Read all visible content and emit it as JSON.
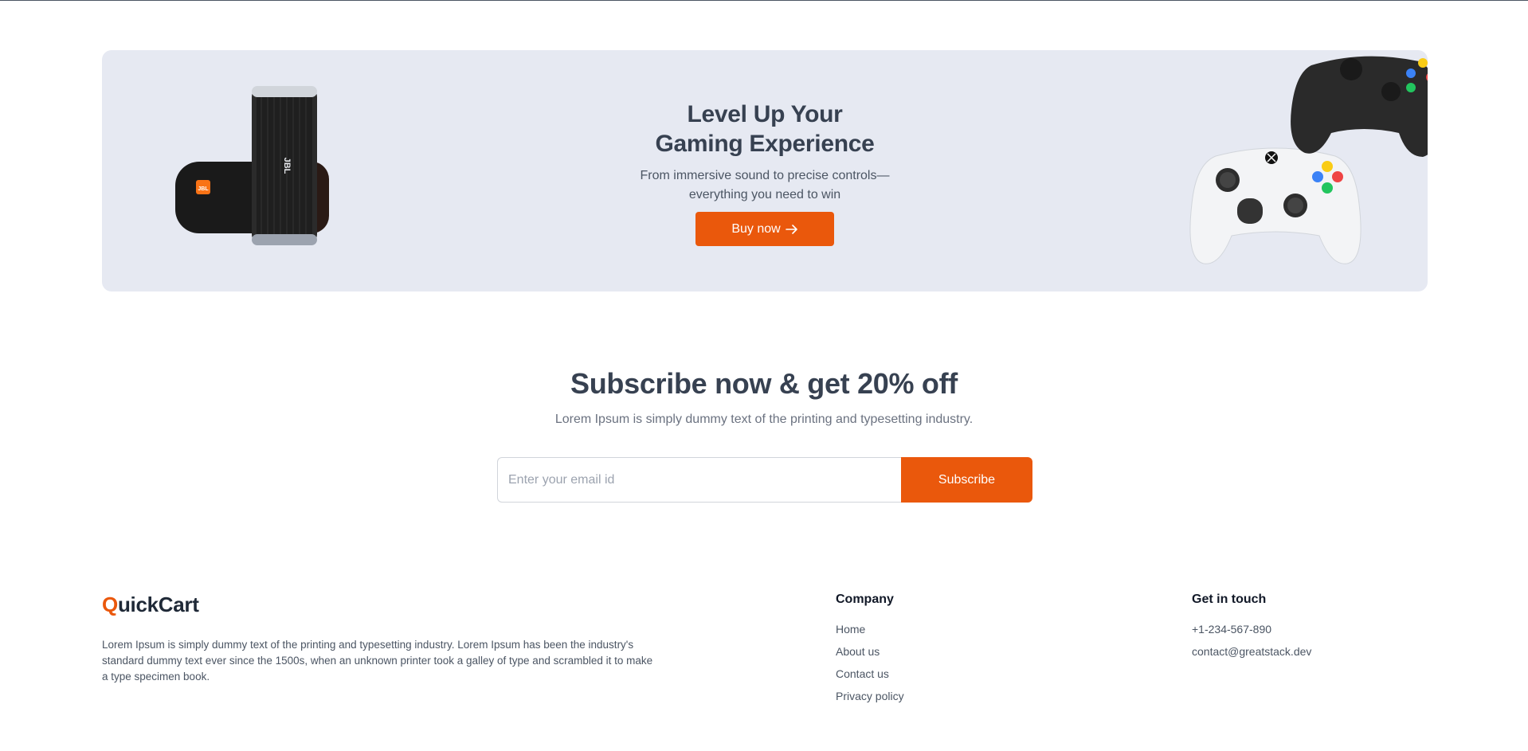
{
  "banner": {
    "title_line1": "Level Up Your",
    "title_line2": "Gaming Experience",
    "subtitle": "From immersive sound to precise controls—everything you need to win",
    "button_label": "Buy now",
    "button_icon": "arrow-right-icon",
    "speaker_brand": "JBL",
    "accent_color": "#ea580c",
    "background_color": "#e6e9f2"
  },
  "subscribe": {
    "title": "Subscribe now & get 20% off",
    "subtitle": "Lorem Ipsum is simply dummy text of the printing and typesetting industry.",
    "email_placeholder": "Enter your email id",
    "email_value": "",
    "button_label": "Subscribe"
  },
  "footer": {
    "logo_first_letter": "Q",
    "logo_rest": "uickCart",
    "about": "Lorem Ipsum is simply dummy text of the printing and typesetting industry. Lorem Ipsum has been the industry's standard dummy text ever since the 1500s, when an unknown printer took a galley of type and scrambled it to make a type specimen book.",
    "company": {
      "heading": "Company",
      "links": [
        "Home",
        "About us",
        "Contact us",
        "Privacy policy"
      ]
    },
    "contact": {
      "heading": "Get in touch",
      "phone": "+1-234-567-890",
      "email": "contact@greatstack.dev"
    }
  }
}
